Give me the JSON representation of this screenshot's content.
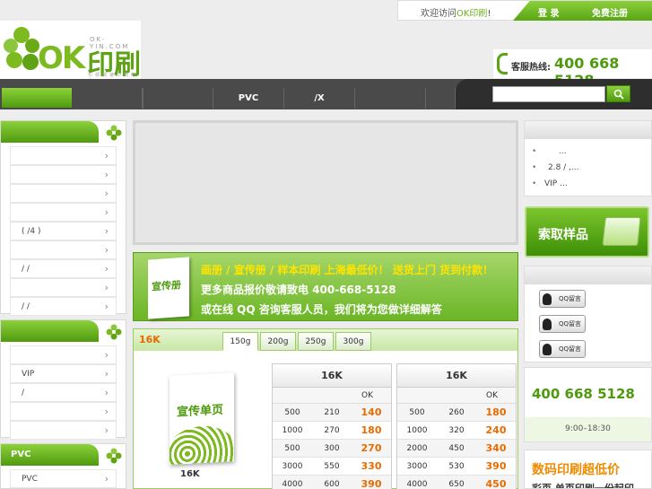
{
  "header": {
    "logo_text_ok": "OK",
    "logo_text_cn": "印刷",
    "logo_url": "OK-YIN.COM",
    "logo_slogan": "引领快速印刷时代",
    "welcome_prefix": "欢迎访问",
    "welcome_brand": "OK印刷",
    "welcome_suffix": "!",
    "login_label": "登 录",
    "register_label": "免费注册",
    "hotline_label": "客服热线:",
    "hotline_number": "400 668 5128"
  },
  "nav": {
    "items": [
      "",
      "",
      "PVC",
      "",
      "/X",
      "",
      ""
    ]
  },
  "search": {
    "placeholder": ""
  },
  "left_sidebar": {
    "box1": {
      "title": "",
      "items": [
        "",
        "",
        "",
        "",
        "( /4 )",
        "",
        "/  /",
        "",
        "/  /"
      ]
    },
    "box2": {
      "title": "",
      "items": [
        "",
        "VIP",
        "/",
        "",
        ""
      ]
    },
    "box3": {
      "title": "PVC",
      "items": [
        "PVC"
      ]
    }
  },
  "promo": {
    "book_title": "宣传册",
    "line1_hl": "画册 / 宣传册 / 样本印刷 上海最低价！ 送货上门 货到付款！",
    "line2": "更多商品报价敬请致电 400-668-5128",
    "line3": "或在线 QQ 咨询客服人员，我们将为您做详细解答"
  },
  "price_panel": {
    "size_label": "16K",
    "tabs": [
      "150g",
      "200g",
      "250g",
      "300g"
    ],
    "active_tab": "150g",
    "sample_title": "宣传单页",
    "sample_label": "16K",
    "tables": [
      {
        "header": "16K",
        "ok_label": "OK",
        "rows": [
          [
            "500",
            "210",
            "140"
          ],
          [
            "1000",
            "270",
            "180"
          ],
          [
            "500",
            "300",
            "270"
          ],
          [
            "3000",
            "550",
            "330"
          ],
          [
            "4000",
            "600",
            "390"
          ]
        ]
      },
      {
        "header": "16K",
        "ok_label": "OK",
        "rows": [
          [
            "500",
            "260",
            "180"
          ],
          [
            "1000",
            "320",
            "240"
          ],
          [
            "2000",
            "450",
            "340"
          ],
          [
            "3000",
            "530",
            "390"
          ],
          [
            "4000",
            "650",
            "450"
          ]
        ]
      }
    ]
  },
  "right_sidebar": {
    "news": [
      "...",
      "2.8 / ,...",
      "VIP     ..."
    ],
    "sample_button": "索取样品",
    "qq_label": "QQ留言",
    "phone_number": "400 668 5128",
    "hours": "9:00–18:30",
    "digital_title": "数码印刷超低价",
    "digital_sub": "彩页 单页印刷一份起印"
  },
  "colors": {
    "brand_green": "#7dba1f",
    "price_orange": "#e86b00",
    "nav_dark": "#4a4a4a"
  }
}
